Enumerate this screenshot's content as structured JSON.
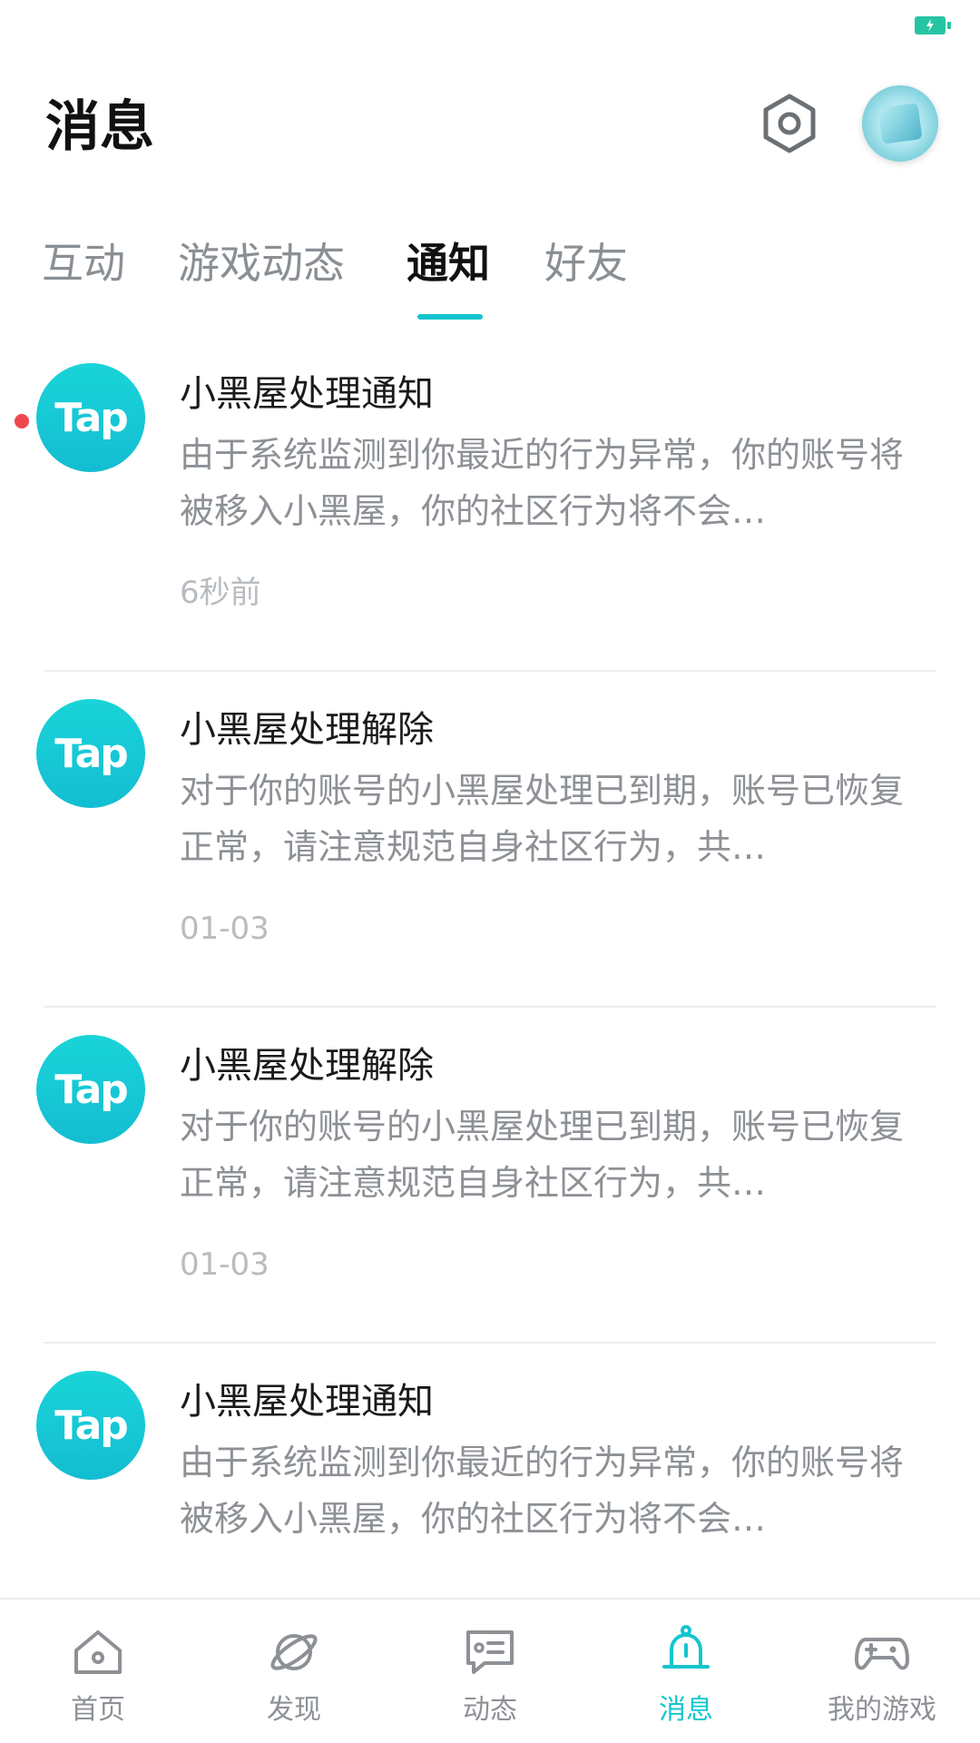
{
  "header": {
    "title": "消息"
  },
  "tabs": [
    {
      "label": "互动",
      "active": false
    },
    {
      "label": "游戏动态",
      "active": false
    },
    {
      "label": "通知",
      "active": true
    },
    {
      "label": "好友",
      "active": false
    }
  ],
  "notifications": [
    {
      "title": "小黑屋处理通知",
      "body": "由于系统监测到你最近的行为异常，你的账号将被移入小黑屋，你的社区行为将不会…",
      "time": "6秒前",
      "unread": true,
      "avatar_text": "Tap"
    },
    {
      "title": "小黑屋处理解除",
      "body": "对于你的账号的小黑屋处理已到期，账号已恢复正常，请注意规范自身社区行为，共…",
      "time": "01-03",
      "unread": false,
      "avatar_text": "Tap"
    },
    {
      "title": "小黑屋处理解除",
      "body": "对于你的账号的小黑屋处理已到期，账号已恢复正常，请注意规范自身社区行为，共…",
      "time": "01-03",
      "unread": false,
      "avatar_text": "Tap"
    },
    {
      "title": "小黑屋处理通知",
      "body": "由于系统监测到你最近的行为异常，你的账号将被移入小黑屋，你的社区行为将不会…",
      "unread": false,
      "avatar_text": "Tap"
    }
  ],
  "bottom_nav": [
    {
      "label": "首页",
      "icon": "home-icon",
      "active": false
    },
    {
      "label": "发现",
      "icon": "planet-icon",
      "active": false
    },
    {
      "label": "动态",
      "icon": "feed-icon",
      "active": false
    },
    {
      "label": "消息",
      "icon": "bell-icon",
      "active": true
    },
    {
      "label": "我的游戏",
      "icon": "gamepad-icon",
      "active": false
    }
  ],
  "colors": {
    "accent": "#15c5ce",
    "unread_dot": "#f0474f",
    "battery": "#27c4a3",
    "text_primary": "#1a1a1a",
    "text_secondary": "#8d9196",
    "text_tertiary": "#b8bcc0"
  }
}
